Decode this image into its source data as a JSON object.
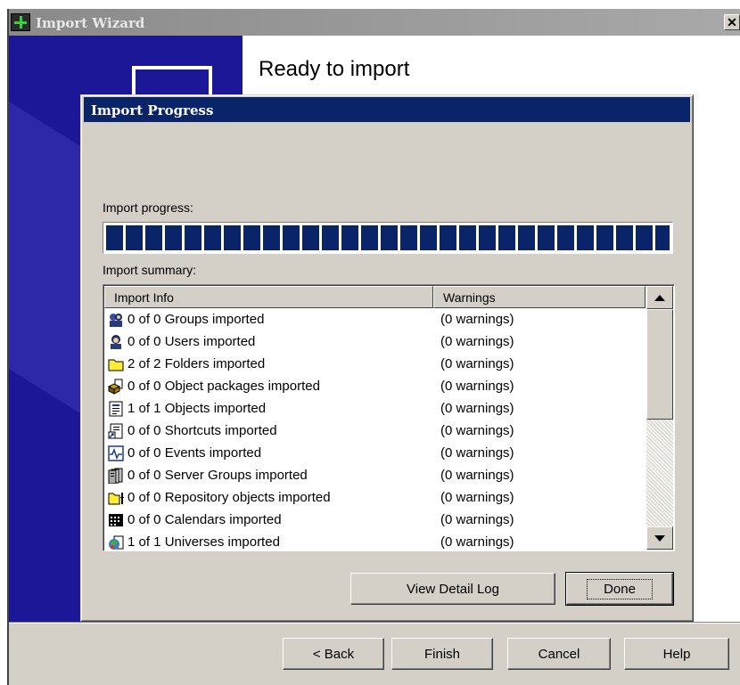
{
  "wizard": {
    "title": "Import Wizard",
    "close_glyph": "✕",
    "heading": "Ready to import",
    "buttons": {
      "back_label": "< Back",
      "finish_label": "Finish",
      "cancel_label": "Cancel",
      "help_label": "Help"
    }
  },
  "dialog": {
    "title": "Import Progress",
    "progress_label": "Import progress:",
    "progress_value": 1.0,
    "summary_label": "Import summary:",
    "columns": {
      "info": "Import Info",
      "warnings": "Warnings"
    },
    "rows": [
      {
        "icon": "groups-icon",
        "info": "0 of 0 Groups imported",
        "warnings": "(0 warnings)"
      },
      {
        "icon": "user-icon",
        "info": "0 of 0 Users imported",
        "warnings": "(0 warnings)"
      },
      {
        "icon": "folder-icon",
        "info": "2 of 2 Folders imported",
        "warnings": "(0 warnings)"
      },
      {
        "icon": "object-package-icon",
        "info": "0 of 0 Object packages imported",
        "warnings": "(0 warnings)"
      },
      {
        "icon": "object-icon",
        "info": "1 of 1 Objects imported",
        "warnings": "(0 warnings)"
      },
      {
        "icon": "shortcut-icon",
        "info": "0 of 0 Shortcuts imported",
        "warnings": "(0 warnings)"
      },
      {
        "icon": "event-icon",
        "info": "0 of 0 Events imported",
        "warnings": "(0 warnings)"
      },
      {
        "icon": "server-group-icon",
        "info": "0 of 0 Server Groups imported",
        "warnings": "(0 warnings)"
      },
      {
        "icon": "repository-object-icon",
        "info": "0 of 0 Repository objects imported",
        "warnings": "(0 warnings)"
      },
      {
        "icon": "calendar-icon",
        "info": "0 of 0 Calendars imported",
        "warnings": "(0 warnings)"
      },
      {
        "icon": "universe-icon",
        "info": "1 of 1 Universes imported",
        "warnings": "(0 warnings)"
      }
    ],
    "buttons": {
      "view_log_label": "View Detail Log",
      "done_label": "Done"
    }
  },
  "colors": {
    "banner": "#1b1796",
    "dialog_titlebar": "#0a246a",
    "progress_fill": "#0a246a",
    "face": "#d4d0c8"
  }
}
